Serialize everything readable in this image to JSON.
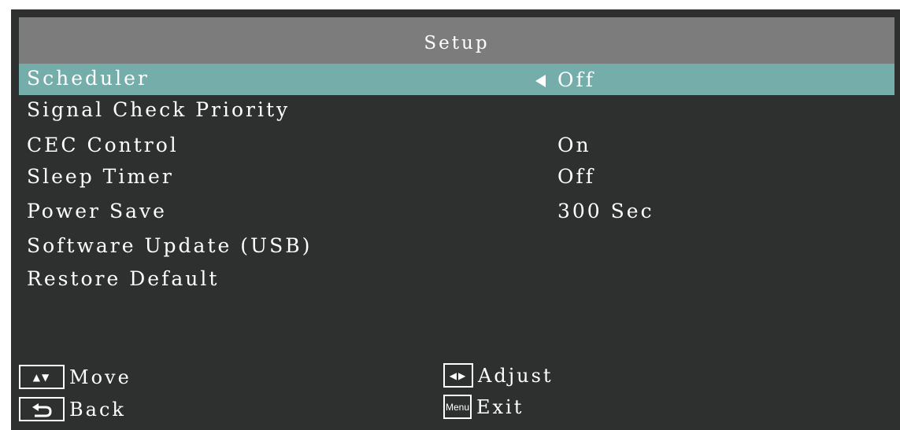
{
  "title": "Setup",
  "items": [
    {
      "label": "Scheduler",
      "value": "Off",
      "selected": true
    },
    {
      "label": "Signal Check Priority",
      "value": ""
    },
    {
      "label": "CEC Control",
      "value": "On"
    },
    {
      "label": "Sleep Timer",
      "value": "Off"
    },
    {
      "label": "Power Save",
      "value": "300 Sec"
    },
    {
      "label": "Software Update (USB)",
      "value": ""
    },
    {
      "label": "Restore Default",
      "value": ""
    }
  ],
  "footer": {
    "move_label": "Move",
    "back_label": "Back",
    "adjust_label": "Adjust",
    "exit_label": "Exit",
    "menu_key_label": "Menu",
    "move_icon": "up-down-triangles-icon",
    "back_icon": "return-arrow-icon",
    "adjust_icon": "left-right-triangles-icon"
  },
  "colors": {
    "background": "#2e302f",
    "title_bar": "#7b7c7b",
    "selected_row": "#75adab",
    "text": "#ffffff"
  }
}
